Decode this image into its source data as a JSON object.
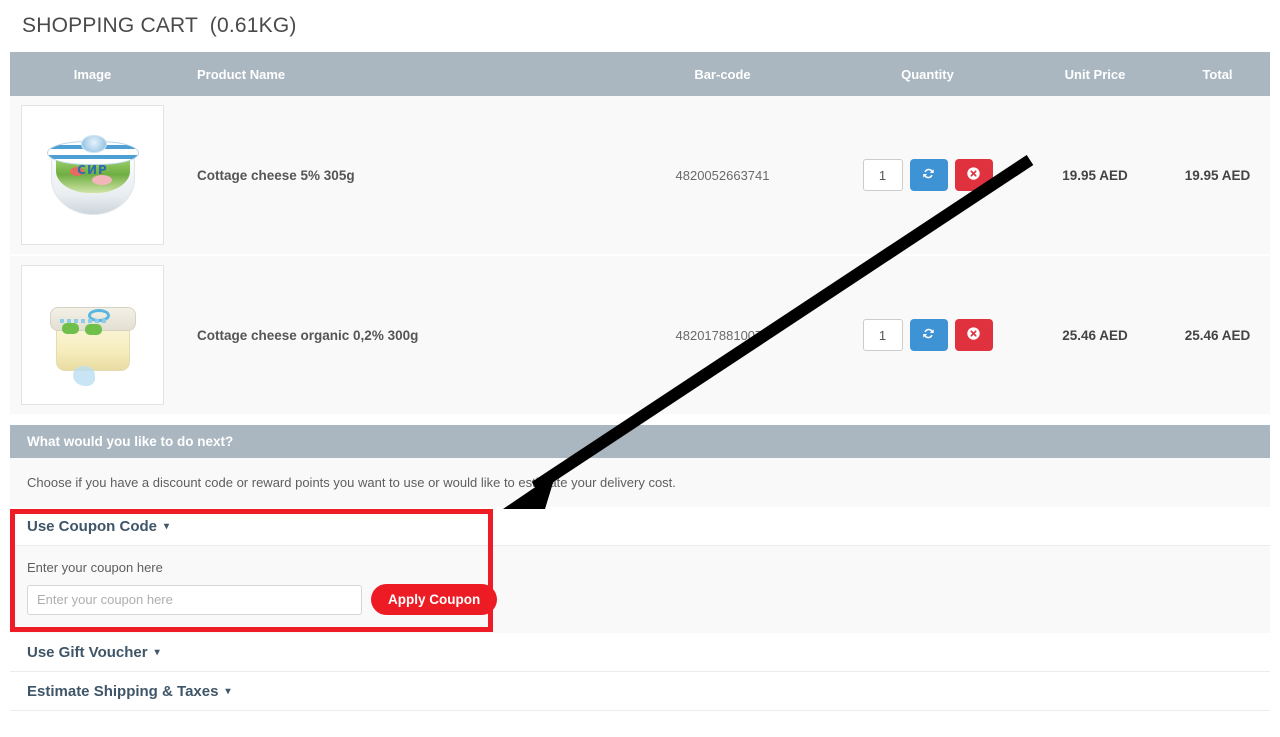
{
  "page": {
    "title": "SHOPPING CART  (0.61KG)"
  },
  "table": {
    "headers": {
      "image": "Image",
      "product_name": "Product Name",
      "barcode": "Bar-code",
      "quantity": "Quantity",
      "unit_price": "Unit Price",
      "total": "Total"
    },
    "rows": [
      {
        "name": "Cottage cheese 5% 305g",
        "barcode": "4820052663741",
        "quantity": "1",
        "unit_price": "19.95 AED",
        "total": "19.95 AED",
        "image_alt": "cottage-cheese-round-tub",
        "update_icon": "refresh-icon",
        "remove_icon": "remove-circle-icon"
      },
      {
        "name": "Cottage cheese organic 0,2% 300g",
        "barcode": "4820178810074",
        "quantity": "1",
        "unit_price": "25.46 AED",
        "total": "25.46 AED",
        "image_alt": "cottage-cheese-square-tub",
        "update_icon": "refresh-icon",
        "remove_icon": "remove-circle-icon"
      }
    ]
  },
  "next_steps": {
    "heading": "What would you like to do next?",
    "description": "Choose if you have a discount code or reward points you want to use or would like to estimate your delivery cost."
  },
  "accordion": {
    "coupon": {
      "title": "Use Coupon Code",
      "caret": "▾",
      "field_label": "Enter your coupon here",
      "input_value": "",
      "input_placeholder": "Enter your coupon here",
      "apply_label": "Apply Coupon"
    },
    "gift_voucher": {
      "title": "Use Gift Voucher",
      "caret": "▾"
    },
    "shipping": {
      "title": "Estimate Shipping & Taxes",
      "caret": "▾"
    }
  },
  "colors": {
    "header_bar": "#aab7c0",
    "accent_red": "#ed1c24",
    "update_blue": "#3d93d4",
    "remove_red": "#e0313f",
    "annotation_red": "#ee1c25",
    "row_background": "#f9f9f9",
    "heading_text": "#3f5668"
  }
}
